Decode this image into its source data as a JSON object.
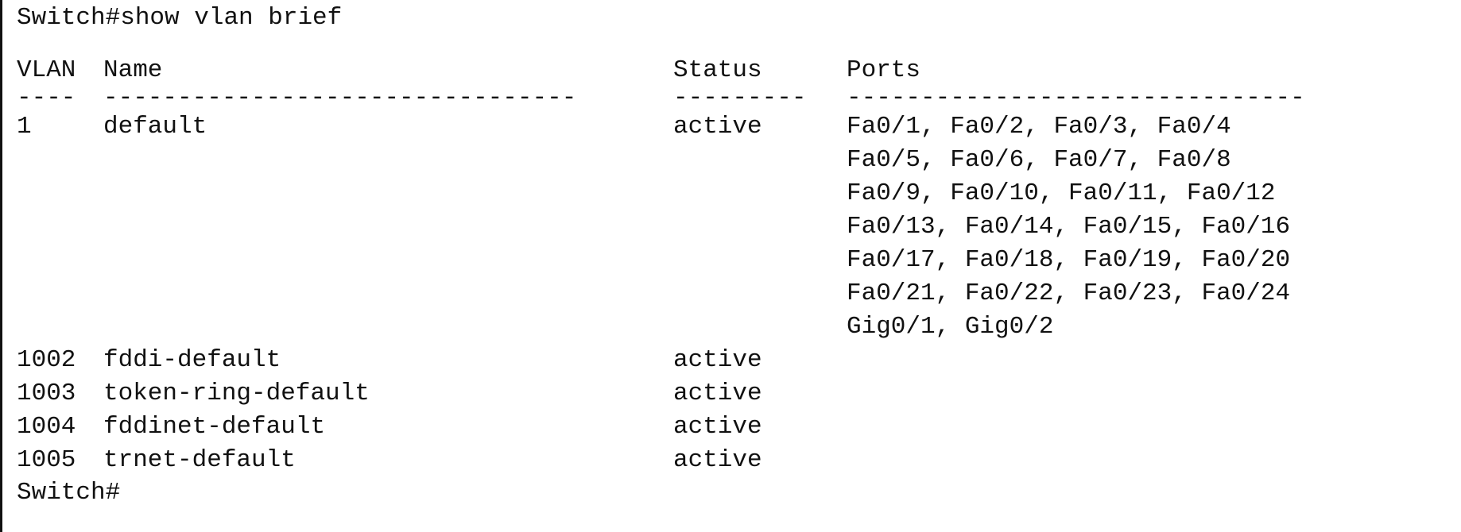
{
  "terminal": {
    "command_line": "Switch#show vlan brief",
    "prompt_end": "Switch#",
    "header": {
      "vlan": "VLAN",
      "name": "Name",
      "status": "Status",
      "ports": "Ports"
    },
    "separator": {
      "vlan": "----",
      "name": "--------------------------------",
      "status": "---------",
      "ports": "-------------------------------"
    },
    "rows": [
      {
        "vlan": "1",
        "name": "default",
        "status": "active",
        "ports": [
          "Fa0/1, Fa0/2, Fa0/3, Fa0/4",
          "Fa0/5, Fa0/6, Fa0/7, Fa0/8",
          "Fa0/9, Fa0/10, Fa0/11, Fa0/12",
          "Fa0/13, Fa0/14, Fa0/15, Fa0/16",
          "Fa0/17, Fa0/18, Fa0/19, Fa0/20",
          "Fa0/21, Fa0/22, Fa0/23, Fa0/24",
          "Gig0/1, Gig0/2"
        ]
      },
      {
        "vlan": "1002",
        "name": "fddi-default",
        "status": "active"
      },
      {
        "vlan": "1003",
        "name": "token-ring-default",
        "status": "active"
      },
      {
        "vlan": "1004",
        "name": "fddinet-default",
        "status": "active"
      },
      {
        "vlan": "1005",
        "name": "trnet-default",
        "status": "active"
      }
    ]
  }
}
